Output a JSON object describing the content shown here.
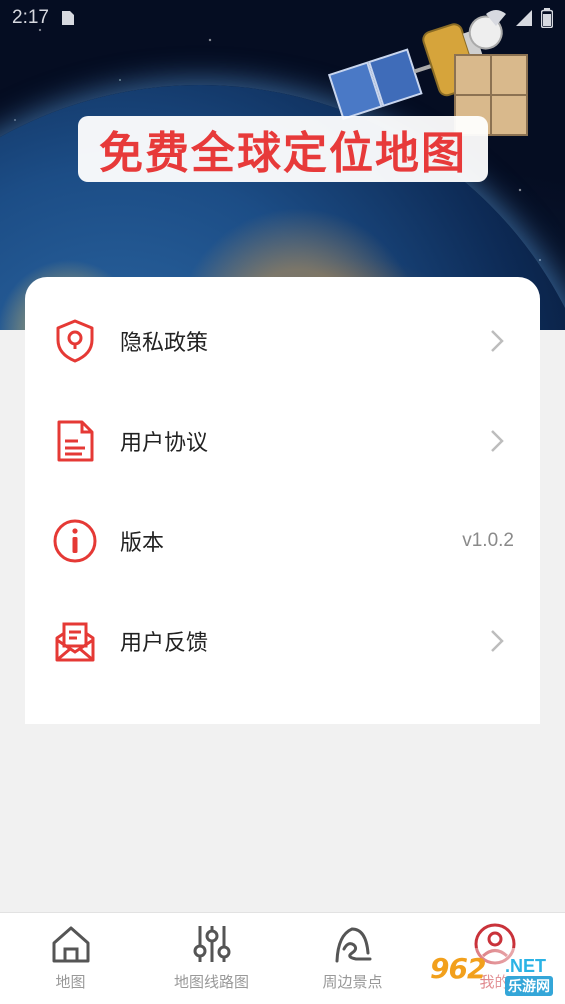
{
  "status_bar": {
    "time": "2:17"
  },
  "hero": {
    "title": "免费全球定位地图"
  },
  "menu": {
    "items": [
      {
        "label": "隐私政策",
        "icon": "shield-lock-icon"
      },
      {
        "label": "用户协议",
        "icon": "document-icon"
      },
      {
        "label": "版本",
        "icon": "info-icon",
        "value": "v1.0.2"
      },
      {
        "label": "用户反馈",
        "icon": "mail-icon"
      }
    ]
  },
  "tabbar": {
    "tabs": [
      {
        "label": "地图",
        "icon": "home-icon"
      },
      {
        "label": "地图线路图",
        "icon": "sliders-icon"
      },
      {
        "label": "周边景点",
        "icon": "landmark-icon"
      },
      {
        "label": "我的",
        "icon": "user-icon",
        "active": true
      }
    ]
  },
  "watermark": {
    "main": "962",
    "net": ".NET",
    "sub": "乐游网"
  },
  "colors": {
    "accent": "#e53935",
    "tab_active": "#c9323a"
  }
}
